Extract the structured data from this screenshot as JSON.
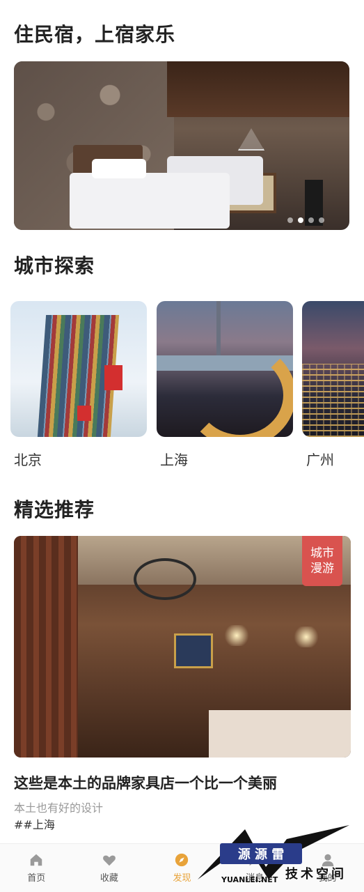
{
  "sections": {
    "hero_title": "住民宿，上宿家乐",
    "city_title": "城市探索",
    "rec_title": "精选推荐"
  },
  "hero": {
    "carousel_count": 4,
    "carousel_active_index": 1
  },
  "cities": [
    {
      "name": "北京"
    },
    {
      "name": "上海"
    },
    {
      "name": "广州"
    }
  ],
  "recommendation": {
    "badge": "城市漫游",
    "title": "这些是本土的品牌家具店一个比一个美丽",
    "description": "本土也有好的设计",
    "tag": "##上海"
  },
  "tabbar": {
    "items": [
      {
        "label": "首页",
        "icon": "home-icon"
      },
      {
        "label": "收藏",
        "icon": "heart-icon"
      },
      {
        "label": "发现",
        "icon": "compass-icon",
        "active": true
      },
      {
        "label": "消息",
        "icon": "message-icon"
      },
      {
        "label": "我的",
        "icon": "user-icon"
      }
    ],
    "active_color": "#e8a33a"
  },
  "watermark": {
    "box": "源 源 雷",
    "text": "技术空间",
    "url": "YUANLEI.NET"
  }
}
